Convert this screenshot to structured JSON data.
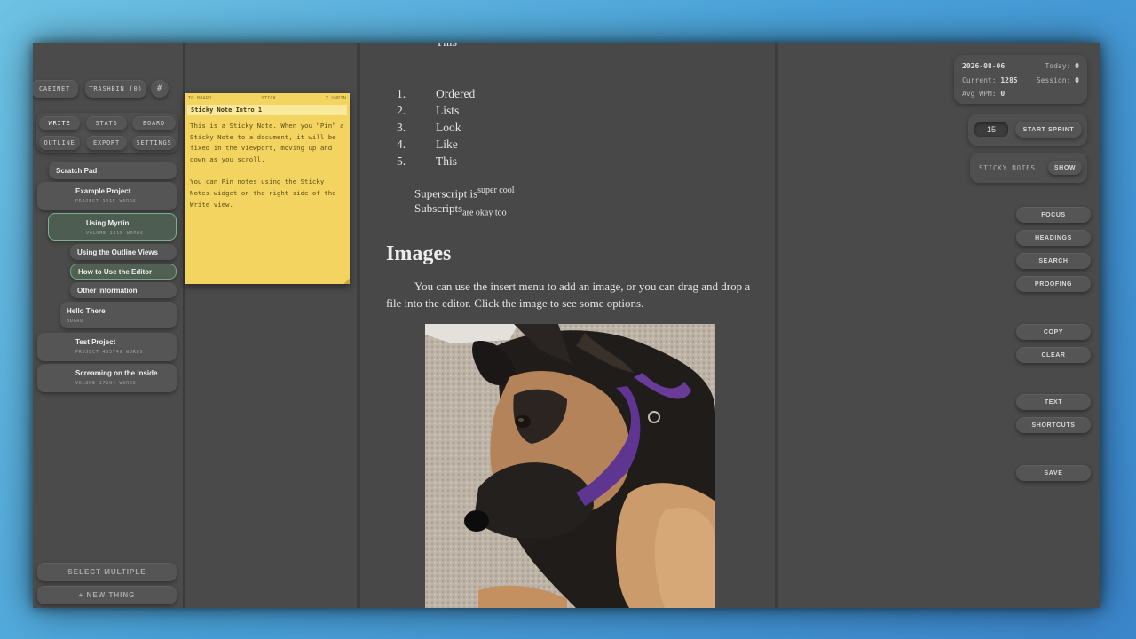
{
  "sidebar": {
    "top_buttons": {
      "cabinet": "CABINET",
      "trashbin": "TRASHBIN (0)",
      "hash": "#"
    },
    "nav": {
      "write": "WRITE",
      "stats": "STATS",
      "board": "BOARD",
      "outline": "OUTLINE",
      "export": "EXPORT",
      "settings": "SETTINGS"
    },
    "tree": {
      "scratch_pad": "Scratch Pad",
      "example_project": {
        "title": "Example Project",
        "meta": "PROJECT   1415 WORDS"
      },
      "using_myrtin": {
        "title": "Using Myrtin",
        "meta": "VOLUME   1415 WORDS"
      },
      "children": [
        "Using the Outline Views",
        "How to Use the Editor",
        "Other Information"
      ],
      "hello_there": {
        "title": "Hello There",
        "meta": "BOARD"
      },
      "test_project": {
        "title": "Test Project",
        "meta": "PROJECT   455749 WORDS"
      },
      "screaming": {
        "title": "Screaming on the Inside",
        "meta": "VOLUME   17294 WORDS"
      }
    },
    "bottom": {
      "select_multiple": "SELECT MULTIPLE",
      "new_thing": "+ NEW THING"
    }
  },
  "sticky": {
    "bar": {
      "to_board": "TO BOARD",
      "stick": "STICK",
      "unpin": "X UNPIN"
    },
    "title": "Sticky Note Intro 1",
    "paragraph1": "This is a Sticky Note. When you “Pin” a Sticky Note to a document, it will be fixed in the viewport, moving up and down as you scroll.",
    "paragraph2": "You can Pin notes using the Sticky Notes widget on the right side of the Write view."
  },
  "editor": {
    "top_cut": "This",
    "ordered_list": [
      {
        "num": "1.",
        "text": "Ordered"
      },
      {
        "num": "2.",
        "text": "Lists"
      },
      {
        "num": "3.",
        "text": "Look"
      },
      {
        "num": "4.",
        "text": "Like"
      },
      {
        "num": "5.",
        "text": "This"
      }
    ],
    "superscript_base": "Superscript is",
    "superscript_text": "super cool",
    "subscript_base": "Subscripts",
    "subscript_text": "are okay too",
    "images_heading": "Images",
    "images_paragraph": "You can use the insert menu to add an image, or you can drag and drop a file into the editor. Click the image to see some options."
  },
  "right": {
    "stats": {
      "date": "2026-08-06",
      "today_label": "Today:",
      "today_value": "0",
      "current_label": "Current:",
      "current_value": "1285",
      "session_label": "Session:",
      "session_value": "0",
      "wpm_label": "Avg WPM:",
      "wpm_value": "0"
    },
    "sprint": {
      "minutes": "15",
      "start": "START SPRINT"
    },
    "sticky_notes": {
      "label": "STICKY NOTES",
      "show": "SHOW"
    },
    "buttons": {
      "focus": "FOCUS",
      "headings": "HEADINGS",
      "search": "SEARCH",
      "proofing": "PROOFING",
      "copy": "COPY",
      "clear": "CLEAR",
      "text": "TEXT",
      "shortcuts": "SHORTCUTS",
      "save": "SAVE"
    }
  },
  "colors": {
    "sticky_bg": "#f4d461",
    "active_green": "#7fb08e",
    "window_bg": "#4a4a4a"
  }
}
